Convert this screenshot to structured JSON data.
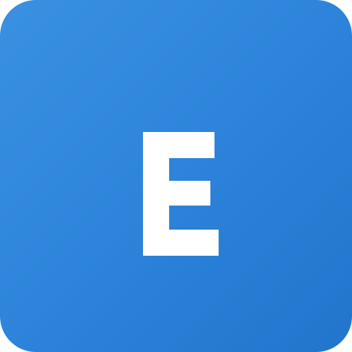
{
  "icon": {
    "letter": "E",
    "background_color_start": "#3a91e2",
    "background_color_end": "#2175cc",
    "letter_color": "#ffffff"
  }
}
